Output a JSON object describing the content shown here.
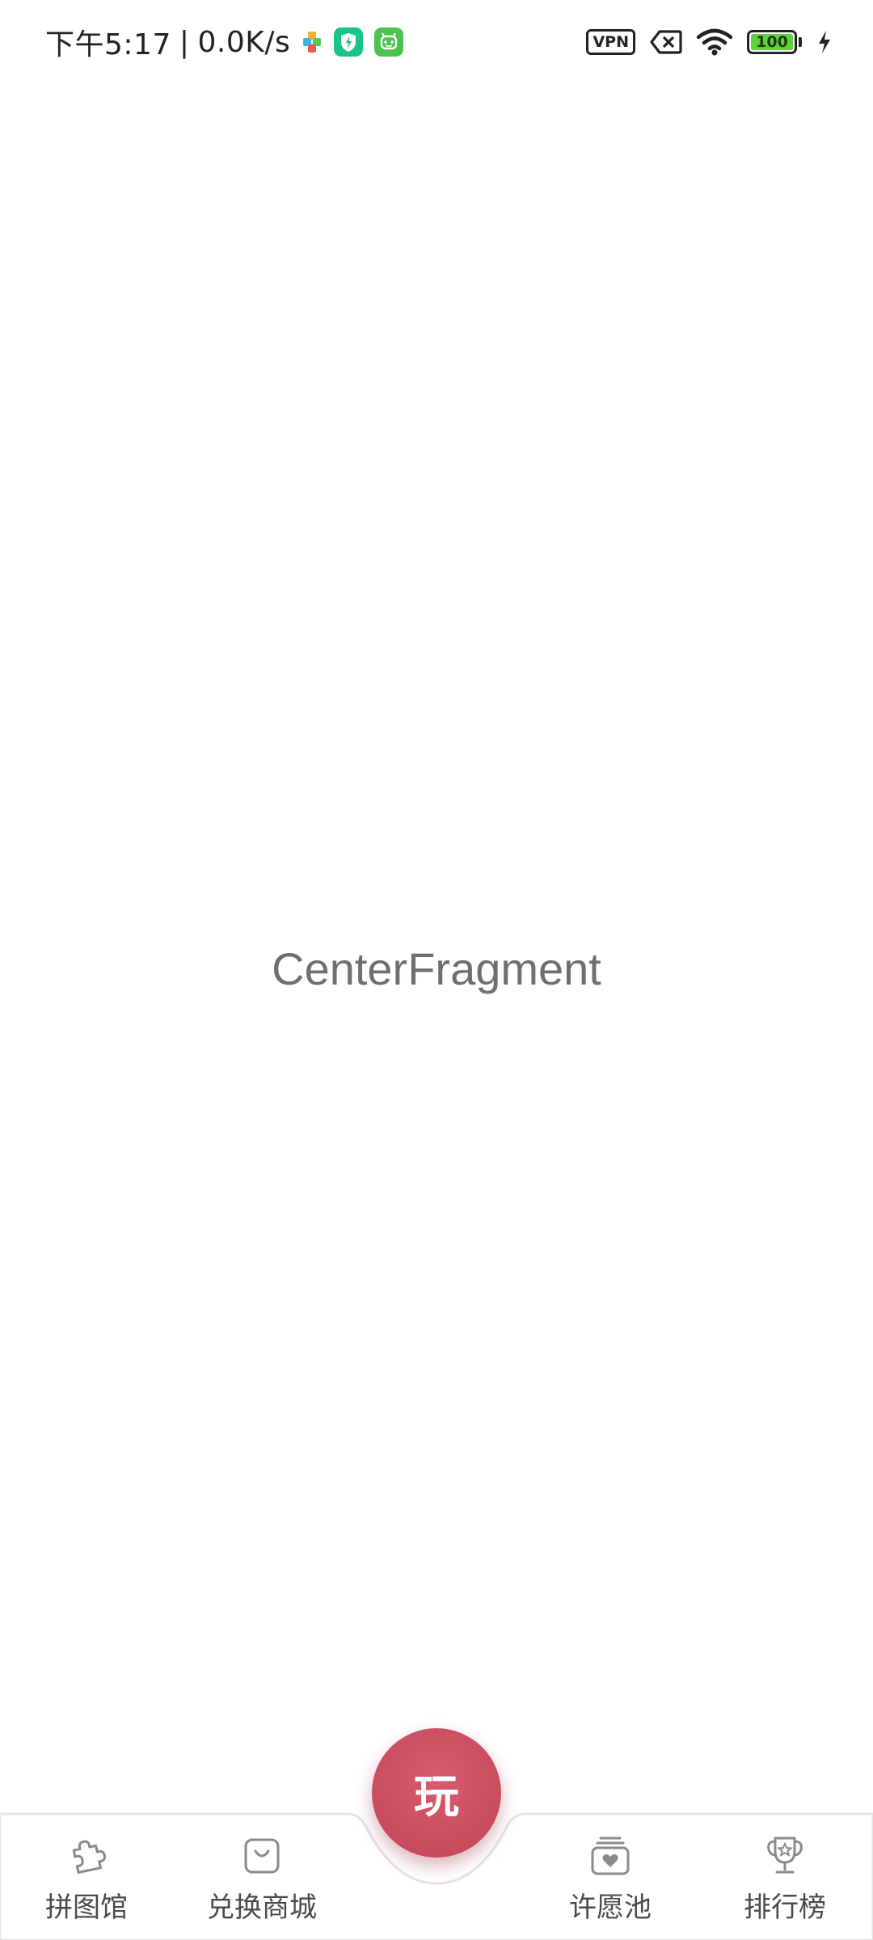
{
  "status_bar": {
    "time": "下午5:17",
    "separator": "|",
    "net_speed": "0.0K/s",
    "notification_icons": [
      "puzzle-app-icon",
      "shield-app-icon",
      "android-app-icon"
    ],
    "vpn_label": "VPN",
    "battery_level": "100",
    "battery_percent": 100,
    "colors": {
      "battery_fill": "#5fd13b",
      "shield_app": "#19c48c",
      "android_app": "#4cc24f"
    }
  },
  "main": {
    "center_text": "CenterFragment"
  },
  "bottom_nav": {
    "items": [
      {
        "label": "拼图馆",
        "icon": "puzzle-icon"
      },
      {
        "label": "兑换商城",
        "icon": "shopping-bag-icon"
      },
      {
        "label": "许愿池",
        "icon": "wish-heart-icon"
      },
      {
        "label": "排行榜",
        "icon": "trophy-icon"
      }
    ],
    "center_button": {
      "label": "玩",
      "color": "#c94c5e"
    }
  }
}
